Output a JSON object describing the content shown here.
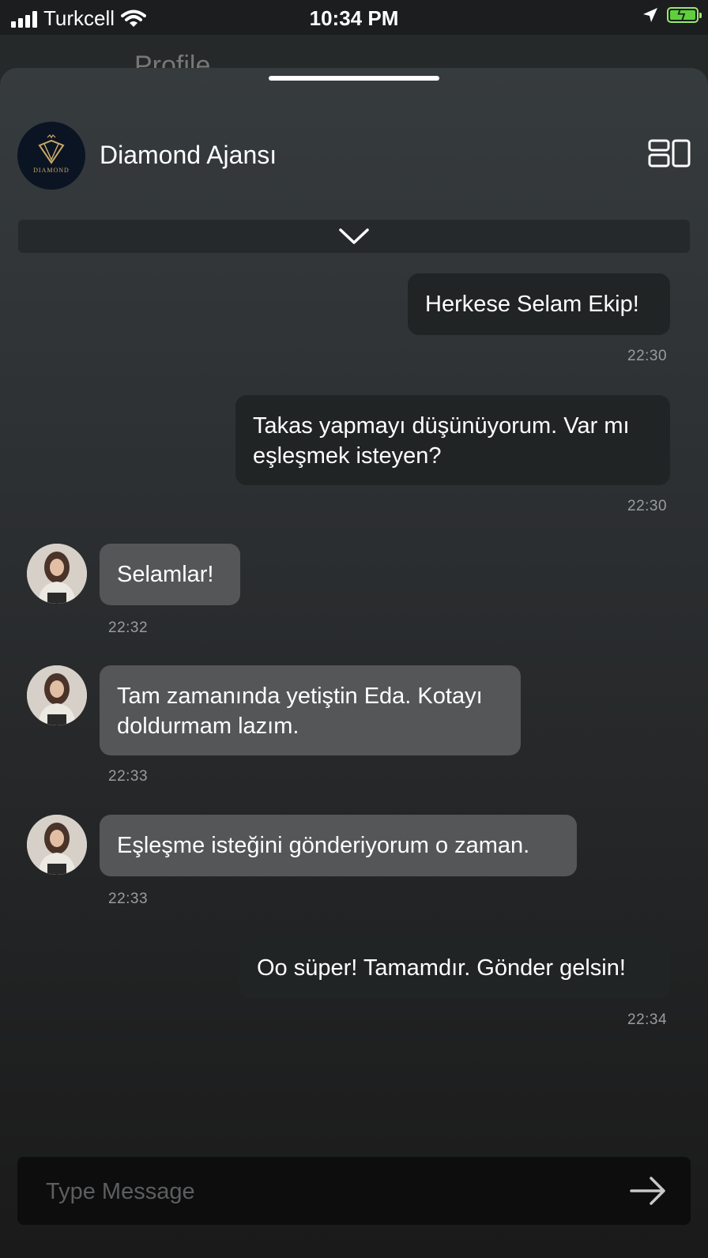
{
  "status_bar": {
    "carrier": "Turkcell",
    "time": "10:34 PM",
    "battery_color": "#5dd13b"
  },
  "behind": {
    "title": "Profile"
  },
  "chat": {
    "title": "Diamond Ajansı",
    "logo_text": "DIAMOND",
    "messages": [
      {
        "dir": "out",
        "text": "Herkese Selam Ekip!",
        "time": "22:30"
      },
      {
        "dir": "out",
        "text": "Takas yapmayı düşünüyorum. Var mı eşleşmek isteyen?",
        "time": "22:30"
      },
      {
        "dir": "in",
        "text": "Selamlar!",
        "time": "22:32"
      },
      {
        "dir": "in",
        "text": "Tam zamanında yetiştin Eda. Kotayı doldurmam lazım.",
        "time": "22:33"
      },
      {
        "dir": "in",
        "text": "Eşleşme isteğini gönderiyorum o zaman.",
        "time": "22:33"
      },
      {
        "dir": "out",
        "text": "Oo süper! Tamamdır. Gönder gelsin!",
        "time": "22:34"
      }
    ]
  },
  "input": {
    "placeholder": "Type Message",
    "value": ""
  },
  "icons": {
    "layout": "layout-icon",
    "collapse": "chevron-down-icon",
    "send": "arrow-right-icon"
  },
  "colors": {
    "bubble_out": "#212425",
    "bubble_in": "#555657",
    "timestamp": "#9a9c9e"
  }
}
